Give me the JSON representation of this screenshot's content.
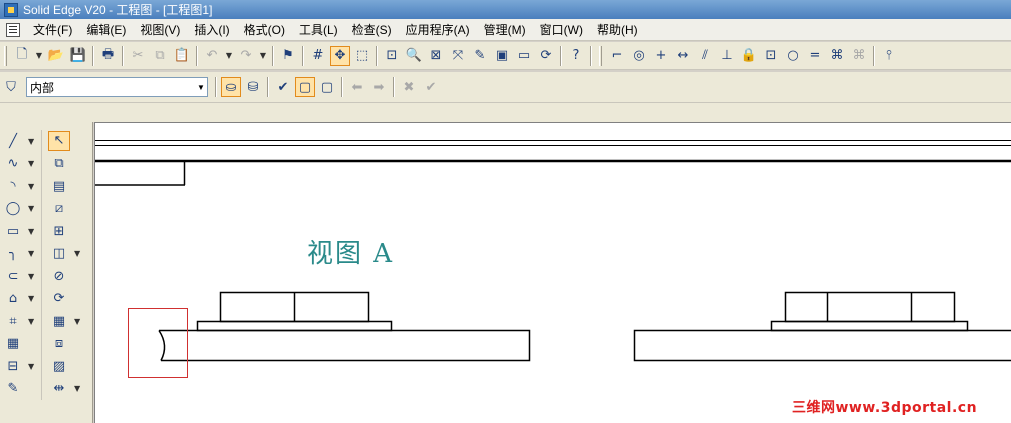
{
  "window": {
    "title": "Solid Edge V20 - 工程图 - [工程图1]"
  },
  "menu": [
    {
      "label": "文件(F)"
    },
    {
      "label": "编辑(E)"
    },
    {
      "label": "视图(V)"
    },
    {
      "label": "插入(I)"
    },
    {
      "label": "格式(O)"
    },
    {
      "label": "工具(L)"
    },
    {
      "label": "检查(S)"
    },
    {
      "label": "应用程序(A)"
    },
    {
      "label": "管理(M)"
    },
    {
      "label": "窗口(W)"
    },
    {
      "label": "帮助(H)"
    }
  ],
  "toolbar2": {
    "combo_value": "内部"
  },
  "canvas": {
    "view_label": "视图 A",
    "watermark": "三维网www.3dportal.cn"
  },
  "colors": {
    "view_label": "#2a8a8a",
    "selection_box": "#d03030",
    "watermark": "#e02222",
    "active_tool": "#ffe3a8"
  }
}
